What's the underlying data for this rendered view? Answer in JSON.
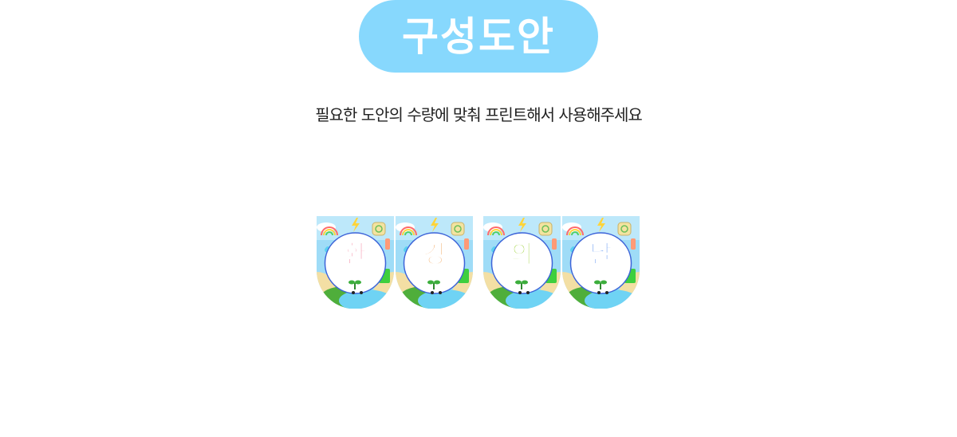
{
  "header": {
    "title": "구성도안",
    "subtitle": "필요한 도안의 수량에 맞춰 프린트해서 사용해주세요"
  },
  "flags": [
    {
      "letter": "환",
      "color": "#f06b8b"
    },
    {
      "letter": "경",
      "color": "#f0a052"
    },
    {
      "letter": "의",
      "color": "#9bd135"
    },
    {
      "letter": "날",
      "color": "#3d7ff0"
    }
  ],
  "colors": {
    "pill": "#87d8fd",
    "sky": "#9fdcf7",
    "circle_border": "#3c63d8",
    "water": "#6fd3f4",
    "grass": "#4fae3b",
    "sand": "#f3dfa4"
  },
  "icons": [
    "rainbow-icon",
    "lightning-icon",
    "recycle-bag-icon",
    "water-drop-icon",
    "bottle-icon",
    "can-icon",
    "recycle-bin-icon",
    "sprout-icon",
    "cloud-icon"
  ]
}
